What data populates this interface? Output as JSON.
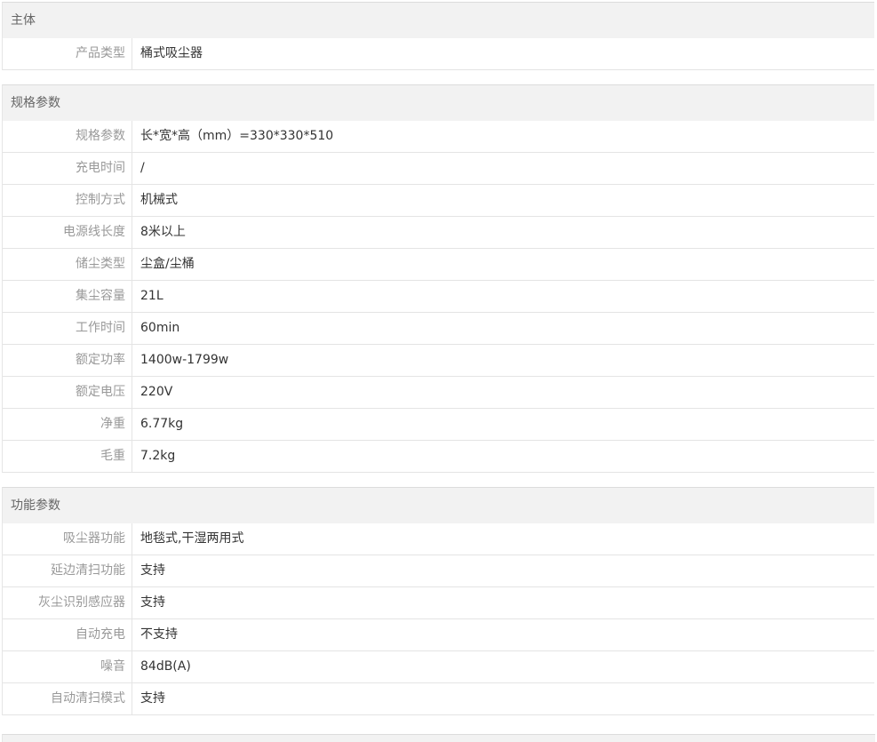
{
  "sections": [
    {
      "title": "主体",
      "rows": [
        {
          "key": "产品类型",
          "value": "桶式吸尘器"
        }
      ]
    },
    {
      "title": "规格参数",
      "rows": [
        {
          "key": "规格参数",
          "value": "长*宽*高（mm）=330*330*510"
        },
        {
          "key": "充电时间",
          "value": "/"
        },
        {
          "key": "控制方式",
          "value": "机械式"
        },
        {
          "key": "电源线长度",
          "value": "8米以上"
        },
        {
          "key": "储尘类型",
          "value": "尘盒/尘桶"
        },
        {
          "key": "集尘容量",
          "value": "21L"
        },
        {
          "key": "工作时间",
          "value": "60min"
        },
        {
          "key": "额定功率",
          "value": "1400w-1799w"
        },
        {
          "key": "额定电压",
          "value": "220V"
        },
        {
          "key": "净重",
          "value": "6.77kg"
        },
        {
          "key": "毛重",
          "value": "7.2kg"
        }
      ]
    },
    {
      "title": "功能参数",
      "rows": [
        {
          "key": "吸尘器功能",
          "value": "地毯式,干湿两用式"
        },
        {
          "key": "延边清扫功能",
          "value": "支持"
        },
        {
          "key": "灰尘识别感应器",
          "value": "支持"
        },
        {
          "key": "自动充电",
          "value": "不支持"
        },
        {
          "key": "噪音",
          "value": "84dB(A)"
        },
        {
          "key": "自动清扫模式",
          "value": "支持"
        }
      ]
    }
  ]
}
